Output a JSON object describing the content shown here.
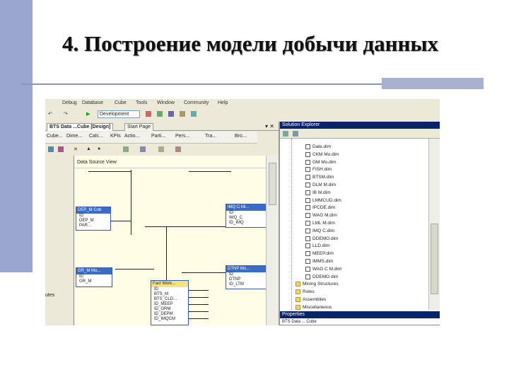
{
  "slide": {
    "title": "4. Построение модели добычи данных",
    "accent_color": "#9aa6cf",
    "rule_color": "#8c96b4"
  },
  "app": {
    "menu": [
      "Debug",
      "Database",
      "Cube",
      "Tools",
      "Window",
      "Community",
      "Help"
    ],
    "config_dropdown": "Development",
    "tabs": [
      {
        "label": "BTS Data ...Cube [Design]",
        "active": true
      },
      {
        "label": "Start Page",
        "active": false
      }
    ],
    "designer_toolbar": [
      "Cube...",
      "Dime...",
      "Calc...",
      "KPIs",
      "Actio...",
      "Parti...",
      "Pers...",
      "Tra...",
      "Bro..."
    ],
    "canvas_header": "Data Source View",
    "left_strip_label": "utes",
    "tables": {
      "dep": {
        "name": "DEP_M Cub",
        "rows": [
          "ID",
          "DEP_M",
          "PAR..."
        ]
      },
      "imq": {
        "name": "IMQ C Mi...",
        "rows": [
          "ID",
          "IMQ_C",
          "ID_IMQ"
        ]
      },
      "gr": {
        "name": "GR_M Mo...",
        "rows": [
          "ID",
          "GR_M"
        ]
      },
      "ltm": {
        "name": "DTNP Mo...",
        "rows": [
          "ID",
          "DTNP",
          "ID_LTM"
        ]
      },
      "fact": {
        "name": "Fact Work...",
        "rows": [
          "ID",
          "BTS_M",
          "BTS_CLD...",
          "ID_MEEP",
          "ID_GRM",
          "ID_DEPM",
          "ID_IMQCM"
        ]
      }
    }
  },
  "solution_explorer": {
    "title": "Solution Explorer",
    "items": [
      {
        "label": "Date.dim",
        "kind": "file"
      },
      {
        "label": "CKM Mo.dim",
        "kind": "file"
      },
      {
        "label": "GM Mo.dim",
        "kind": "file"
      },
      {
        "label": "FISH.dim",
        "kind": "file"
      },
      {
        "label": "BTSM.dim",
        "kind": "file"
      },
      {
        "label": "DLM M.dim",
        "kind": "file"
      },
      {
        "label": "IB M.dim",
        "kind": "file"
      },
      {
        "label": "LMMCUD.dim",
        "kind": "file"
      },
      {
        "label": "IPCDE.dim",
        "kind": "file"
      },
      {
        "label": "WAG M.dim",
        "kind": "file"
      },
      {
        "label": "LML M.dim",
        "kind": "file"
      },
      {
        "label": "IMQ C.dim",
        "kind": "file"
      },
      {
        "label": "DDEMO.dim",
        "kind": "file"
      },
      {
        "label": "LLD.dim",
        "kind": "file"
      },
      {
        "label": "MEEP.dim",
        "kind": "file"
      },
      {
        "label": "IMMS.dim",
        "kind": "file"
      },
      {
        "label": "WAG C M.dim",
        "kind": "file"
      },
      {
        "label": "DDEMO dim",
        "kind": "file"
      },
      {
        "label": "Mining Structures",
        "kind": "folder"
      },
      {
        "label": "Roles",
        "kind": "folder"
      },
      {
        "label": "Assemblies",
        "kind": "folder"
      },
      {
        "label": "Miscellaneous",
        "kind": "folder"
      }
    ],
    "properties_title": "Properties",
    "properties_value": "BTS Data ... Cube"
  }
}
